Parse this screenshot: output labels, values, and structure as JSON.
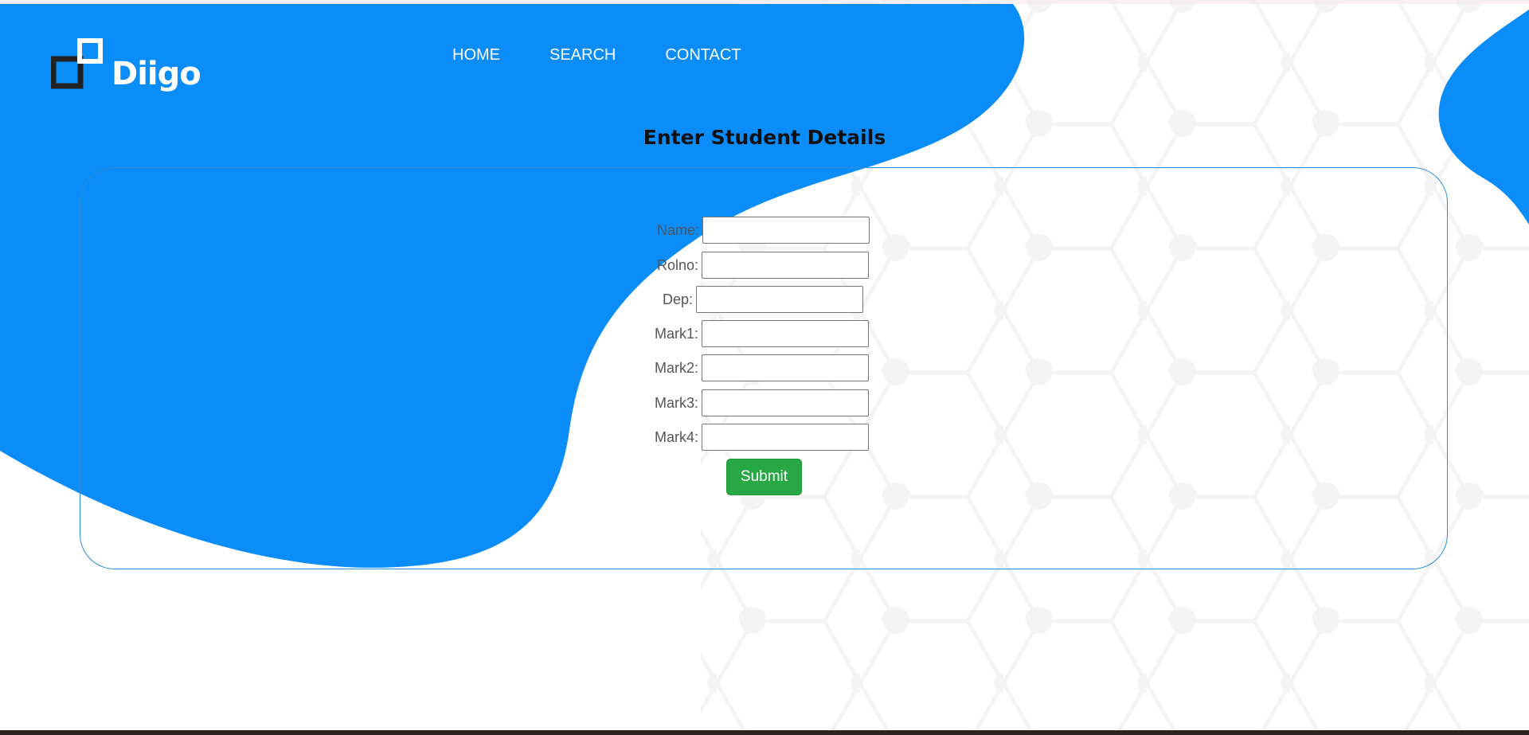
{
  "brand": {
    "name": "Diigo"
  },
  "nav": {
    "items": [
      {
        "label": "HOME"
      },
      {
        "label": "SEARCH"
      },
      {
        "label": "CONTACT"
      }
    ]
  },
  "form": {
    "title": "Enter Student Details",
    "fields": [
      {
        "label": "Name:",
        "value": ""
      },
      {
        "label": "Rolno:",
        "value": ""
      },
      {
        "label": "Dep:",
        "value": ""
      },
      {
        "label": "Mark1:",
        "value": ""
      },
      {
        "label": "Mark2:",
        "value": ""
      },
      {
        "label": "Mark3:",
        "value": ""
      },
      {
        "label": "Mark4:",
        "value": ""
      }
    ],
    "submit_label": "Submit"
  },
  "colors": {
    "accent": "#0a8df8",
    "submit": "#28a745",
    "panel_border": "#2a8fd8"
  },
  "icons": {
    "logo": "squares-logo-icon"
  }
}
